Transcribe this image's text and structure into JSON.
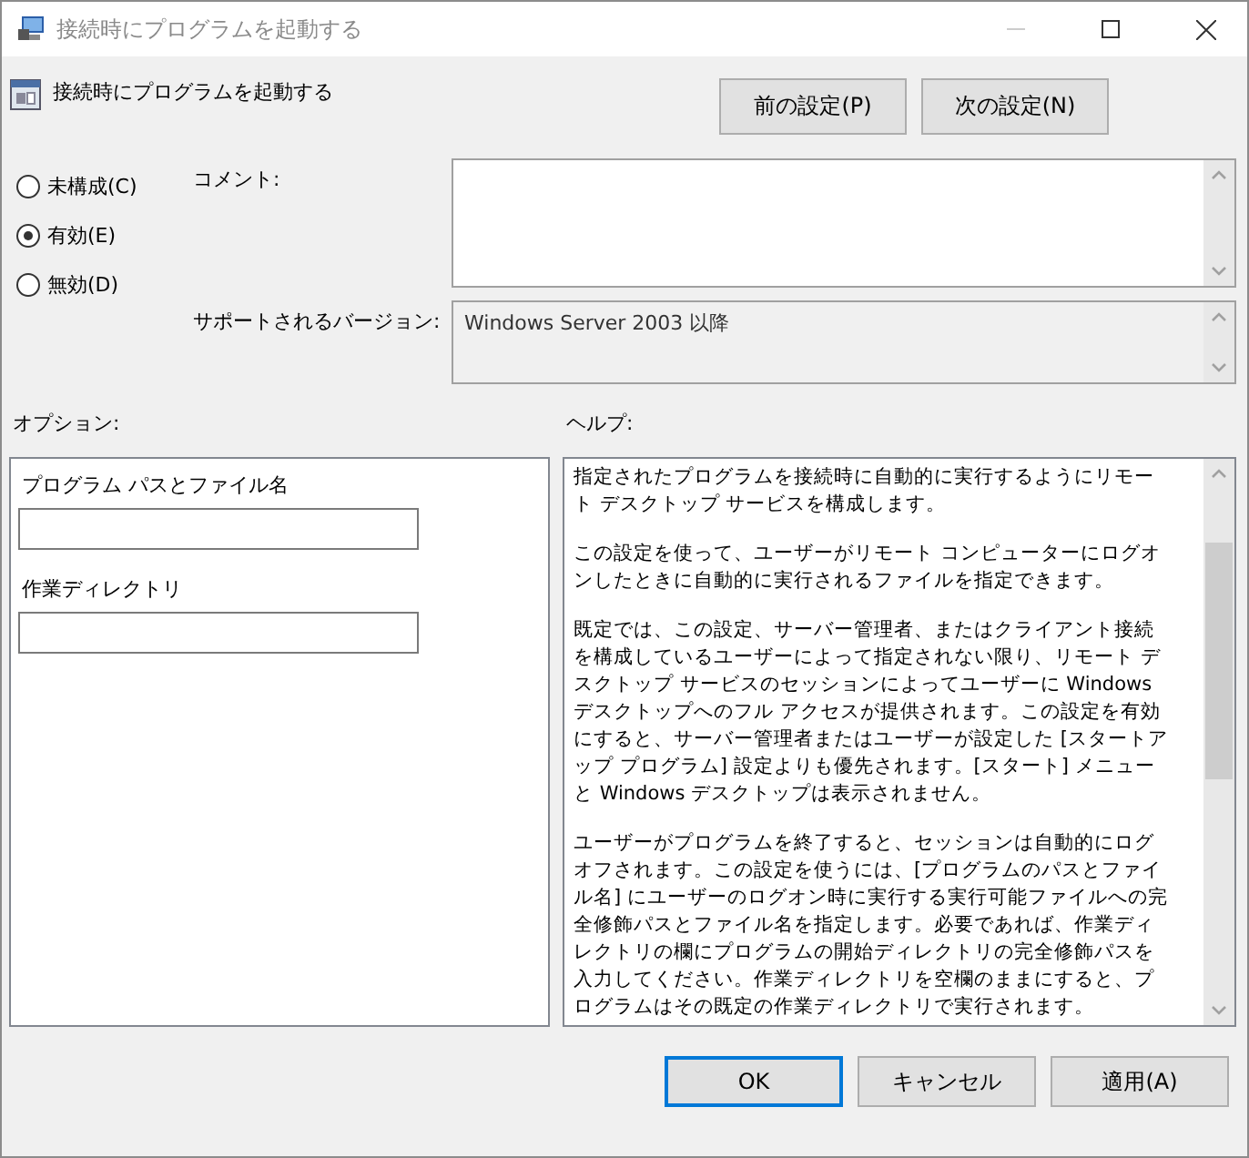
{
  "window": {
    "title": "接続時にプログラムを起動する"
  },
  "heading": "接続時にプログラムを起動する",
  "nav_buttons": [
    "前の設定(P)",
    "次の設定(N)"
  ],
  "state_options": [
    {
      "label": "未構成(C)",
      "selected": false
    },
    {
      "label": "有効(E)",
      "selected": true
    },
    {
      "label": "無効(D)",
      "selected": false
    }
  ],
  "comment": {
    "label": "コメント:"
  },
  "supported": {
    "label": "サポートされるバージョン:",
    "value": "Windows Server 2003 以降"
  },
  "options": {
    "title": "オプション:",
    "fields": [
      {
        "label": "プログラム パスとファイル名"
      },
      {
        "label": "作業ディレクトリ"
      }
    ]
  },
  "help": {
    "title": "ヘルプ:",
    "paragraphs": [
      "指定されたプログラムを接続時に自動的に実行するようにリモート デスクトップ サービスを構成します。",
      "この設定を使って、ユーザーがリモート コンピューターにログオンしたときに自動的に実行されるファイルを指定できます。",
      "既定では、この設定、サーバー管理者、またはクライアント接続を構成しているユーザーによって指定されない限り、リモート デスクトップ サービスのセッションによってユーザーに Windows デスクトップへのフル アクセスが提供されます。この設定を有効にすると、サーバー管理者またはユーザーが設定した [スタートアップ プログラム] 設定よりも優先されます。[スタート] メニューと Windows デスクトップは表示されません。",
      "ユーザーがプログラムを終了すると、セッションは自動的にログオフされます。この設定を使うには、[プログラムのパスとファイル名] にユーザーのログオン時に実行する実行可能ファイルへの完全修飾パスとファイル名を指定します。必要であれば、作業ディレクトリの欄にプログラムの開始ディレクトリの完全修飾パスを入力してください。作業ディレクトリを空欄のままにすると、プログラムはその既定の作業ディレクトリで実行されます。"
    ]
  },
  "buttons": [
    {
      "label": "OK",
      "default": true
    },
    {
      "label": "キャンセル",
      "default": false
    },
    {
      "label": "適用(A)",
      "default": false
    }
  ]
}
